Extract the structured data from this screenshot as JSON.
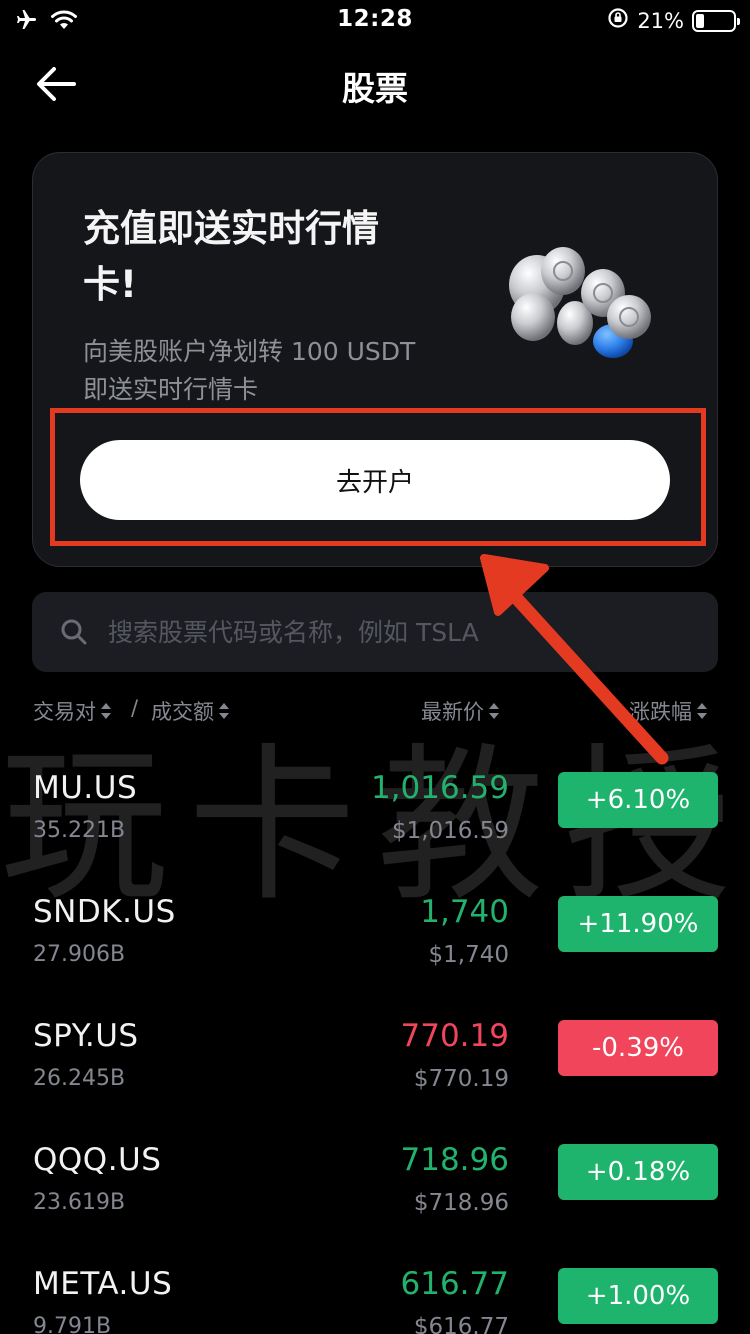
{
  "status_bar": {
    "time": "12:28",
    "battery_text": "21%",
    "battery_level": 0.21,
    "icons": [
      "airplane-mode-icon",
      "wifi-icon",
      "rotation-lock-icon",
      "battery-icon"
    ]
  },
  "nav": {
    "title": "股票",
    "back_icon": "back-arrow-icon"
  },
  "promo": {
    "title": "充值即送实时行情卡!",
    "description_line1": "向美股账户净划转 100 USDT",
    "description_line2": "即送实时行情卡",
    "button_label": "去开户",
    "illustration": "coins-illustration"
  },
  "search": {
    "placeholder": "搜索股票代码或名称，例如 TSLA"
  },
  "table_header": {
    "pair": "交易对",
    "separator": "/",
    "volume": "成交额",
    "price": "最新价",
    "change": "涨跌幅"
  },
  "watermark": "玩卡教授",
  "colors": {
    "up": "#1fb46d",
    "down": "#f0455a",
    "annotation": "#e53a22"
  },
  "rows": [
    {
      "symbol": "MU.US",
      "volume": "35.221B",
      "price": "1,016.59",
      "usd_price": "$1,016.59",
      "change": "+6.10%",
      "direction": "up"
    },
    {
      "symbol": "SNDK.US",
      "volume": "27.906B",
      "price": "1,740",
      "usd_price": "$1,740",
      "change": "+11.90%",
      "direction": "up"
    },
    {
      "symbol": "SPY.US",
      "volume": "26.245B",
      "price": "770.19",
      "usd_price": "$770.19",
      "change": "-0.39%",
      "direction": "down"
    },
    {
      "symbol": "QQQ.US",
      "volume": "23.619B",
      "price": "718.96",
      "usd_price": "$718.96",
      "change": "+0.18%",
      "direction": "up"
    },
    {
      "symbol": "META.US",
      "volume": "9.791B",
      "price": "616.77",
      "usd_price": "$616.77",
      "change": "+1.00%",
      "direction": "up"
    }
  ]
}
